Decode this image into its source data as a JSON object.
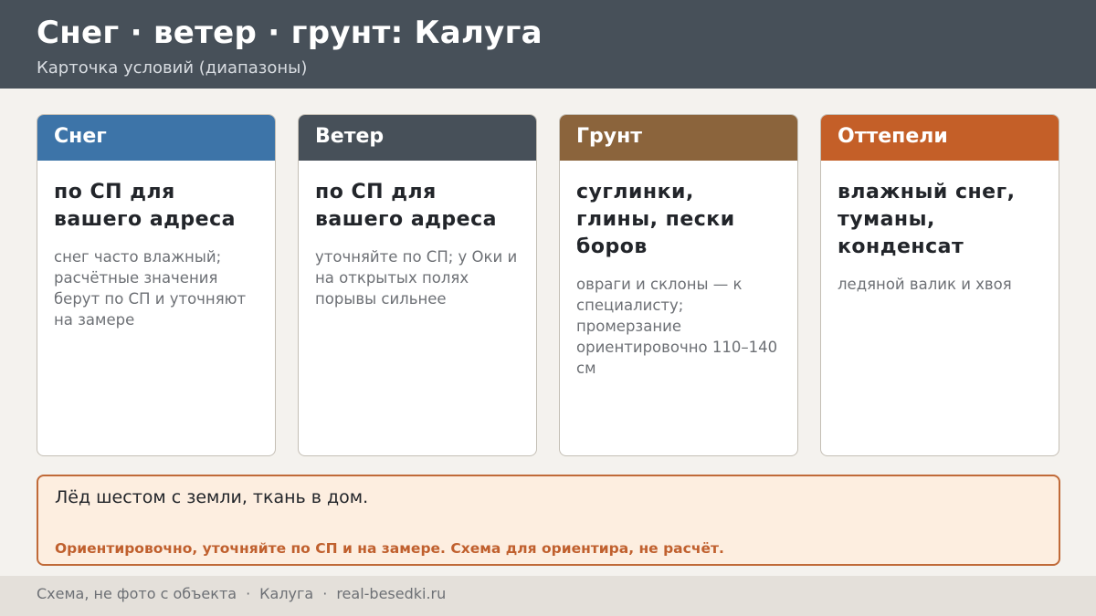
{
  "header": {
    "title": "Снег · ветер · грунт: Калуга",
    "subtitle": "Карточка условий (диапазоны)"
  },
  "cards": [
    {
      "title": "Снег",
      "color": "#3d74a8",
      "main": "по СП для вашего адреса",
      "note": "снег часто влажный; расчётные значения берут по СП и уточняют на замере"
    },
    {
      "title": "Ветер",
      "color": "#475059",
      "main": "по СП для вашего адреса",
      "note": "уточняйте по СП; у Оки и на открытых полях порывы сильнее"
    },
    {
      "title": "Грунт",
      "color": "#8b643c",
      "main": "суглинки, глины, пески боров",
      "note": "овраги и склоны — к специалисту; промерзание ориентировочно 110–140 см"
    },
    {
      "title": "Оттепели",
      "color": "#c45f28",
      "main": "влажный снег, туманы, конденсат",
      "note": "ледяной валик и хвоя"
    }
  ],
  "note_box": {
    "text": "Лёд шестом с земли, ткань в дом.",
    "warning": "Ориентировочно, уточняйте по СП и на замере. Схема для ориентира, не расчёт."
  },
  "footer": {
    "source": "Схема, не фото с объекта",
    "city": "Калуга",
    "site": "real-besedki.ru",
    "separator": "·"
  }
}
